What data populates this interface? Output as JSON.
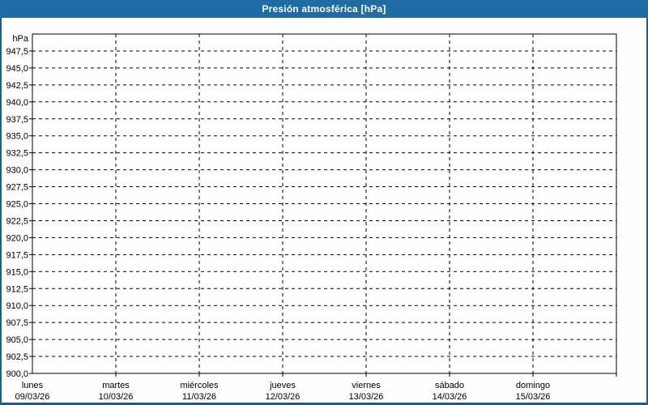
{
  "header": {
    "title": "Presión atmosférica [hPa]"
  },
  "colors": {
    "header_bg": "#1f6ba3",
    "frame_border": "#1d5d8f",
    "plot_bg": "#fdfefd",
    "grid_color": "#000000",
    "axis_color": "#000000",
    "text_color": "#000000",
    "title_color": "#ffffff"
  },
  "chart_data": {
    "type": "line",
    "title": "Presión atmosférica [hPa]",
    "ylabel": "hPa",
    "ylim": [
      900,
      950
    ],
    "ytick_step": 2.5,
    "ytick_labels": [
      "947,5",
      "945,0",
      "942,5",
      "940,0",
      "937,5",
      "935,0",
      "932,5",
      "930,0",
      "927,5",
      "925,0",
      "922,5",
      "920,0",
      "917,5",
      "915,0",
      "912,5",
      "910,0",
      "907,5",
      "905,0",
      "902,5",
      "900,0"
    ],
    "x_days": [
      {
        "name": "lunes",
        "date": "09/03/26"
      },
      {
        "name": "martes",
        "date": "10/03/26"
      },
      {
        "name": "miércoles",
        "date": "11/03/26"
      },
      {
        "name": "jueves",
        "date": "12/03/26"
      },
      {
        "name": "viernes",
        "date": "13/03/26"
      },
      {
        "name": "sábado",
        "date": "14/03/26"
      },
      {
        "name": "domingo",
        "date": "15/03/26"
      }
    ],
    "series": [],
    "grid": {
      "style": "dashed",
      "horizontal": true,
      "vertical": true
    },
    "legend": "none"
  }
}
